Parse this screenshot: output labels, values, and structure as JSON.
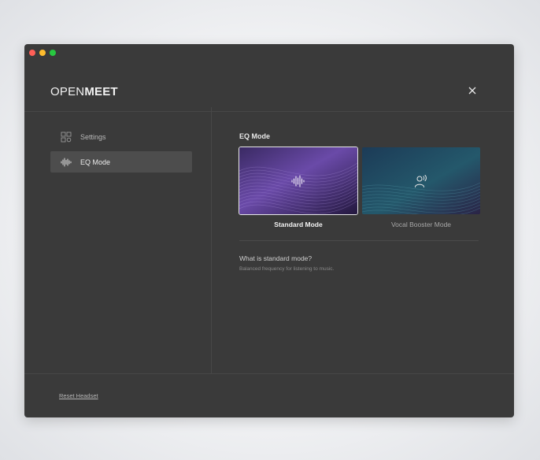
{
  "brand": {
    "logo_thin": "OPEN",
    "logo_bold": "MEET"
  },
  "sidebar": {
    "items": [
      {
        "label": "Settings",
        "icon": "settings-grid-icon",
        "active": false
      },
      {
        "label": "EQ Mode",
        "icon": "waveform-icon",
        "active": true
      }
    ]
  },
  "main": {
    "section_title": "EQ Mode",
    "modes": [
      {
        "label": "Standard Mode",
        "icon": "waveform-icon",
        "selected": true
      },
      {
        "label": "Vocal Booster Mode",
        "icon": "speaking-person-icon",
        "selected": false
      }
    ],
    "info": {
      "title": "What is standard mode?",
      "description": "Balanced frequency for listening to music."
    }
  },
  "footer": {
    "reset_label": "Reset Headset"
  },
  "colors": {
    "window_bg": "#3a3a3a",
    "sidebar_active_bg": "#4d4d4d",
    "standard_card": "#5a3f8c",
    "vocal_card": "#1f4f62"
  }
}
